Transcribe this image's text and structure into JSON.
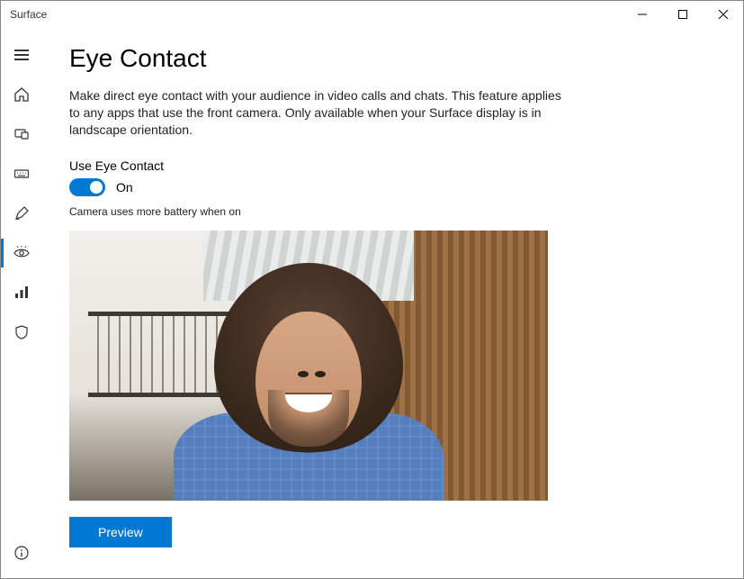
{
  "window": {
    "title": "Surface"
  },
  "sidebar": {
    "items": [
      {
        "name": "menu"
      },
      {
        "name": "home"
      },
      {
        "name": "device"
      },
      {
        "name": "keyboard"
      },
      {
        "name": "pen"
      },
      {
        "name": "eye-contact",
        "active": true
      },
      {
        "name": "data"
      },
      {
        "name": "security"
      }
    ],
    "footer": {
      "name": "info"
    }
  },
  "page": {
    "title": "Eye Contact",
    "description": "Make direct eye contact with your audience in video calls and chats. This feature applies to any apps that use the front camera. Only available when your Surface display is in landscape orientation.",
    "toggle": {
      "label": "Use Eye Contact",
      "state": "On",
      "on": true
    },
    "hint": "Camera uses more battery when on",
    "preview_button": "Preview"
  }
}
